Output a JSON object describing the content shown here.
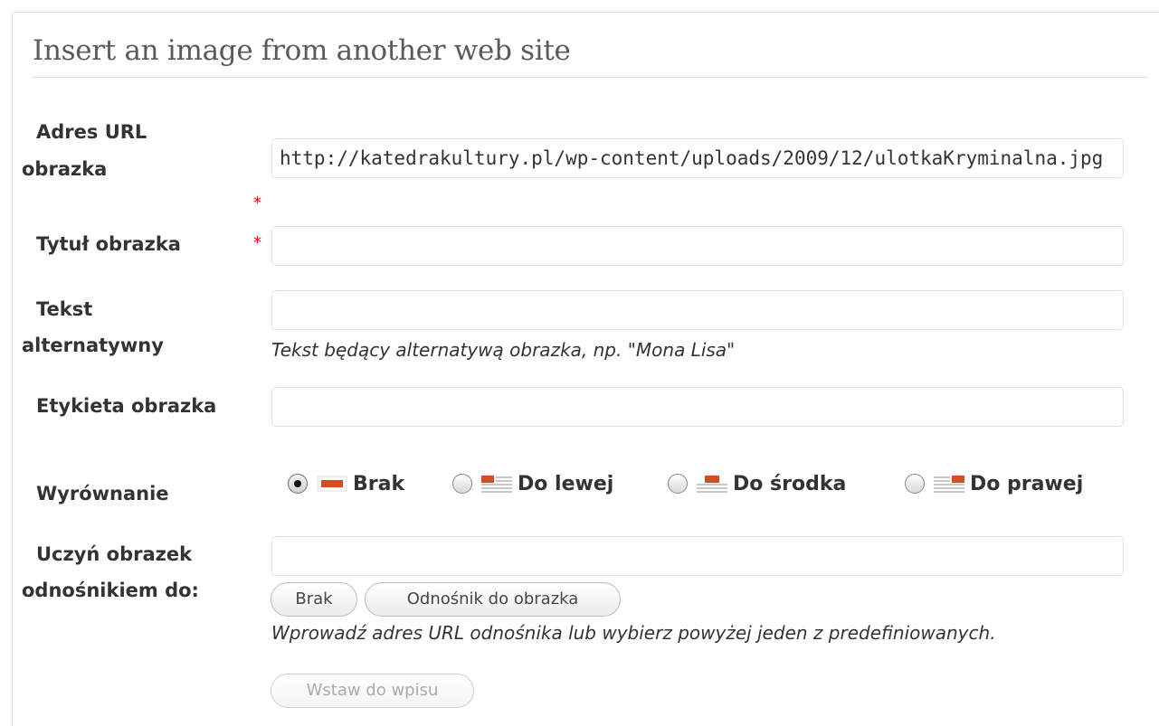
{
  "dialog": {
    "title": "Insert an image from another web site"
  },
  "fields": {
    "url": {
      "label_line1": "Adres URL",
      "label_line2": "obrazka",
      "required_mark": "*",
      "value": "http://katedrakultury.pl/wp-content/uploads/2009/12/ulotkaKryminalna.jpg"
    },
    "title": {
      "label": "Tytuł obrazka",
      "required_mark": "*",
      "value": ""
    },
    "alt": {
      "label_line1": "Tekst",
      "label_line2": "alternatywny",
      "value": "",
      "hint": "Tekst będący alternatywą obrazka, np. \"Mona Lisa\""
    },
    "caption": {
      "label": "Etykieta obrazka",
      "value": ""
    },
    "alignment": {
      "label": "Wyrównanie",
      "selected": "none",
      "options": [
        {
          "id": "none",
          "label": "Brak",
          "icon": "align-none-icon"
        },
        {
          "id": "left",
          "label": "Do lewej",
          "icon": "align-left-icon"
        },
        {
          "id": "center",
          "label": "Do środka",
          "icon": "align-center-icon"
        },
        {
          "id": "right",
          "label": "Do prawej",
          "icon": "align-right-icon"
        }
      ]
    },
    "link": {
      "label_line1": "Uczyń obrazek",
      "label_line2": "odnośnikiem do:",
      "value": "",
      "btn_none": "Brak",
      "btn_image": "Odnośnik do obrazka",
      "hint": "Wprowadź adres URL odnośnika lub wybierz powyżej jeden z predefiniowanych."
    }
  },
  "actions": {
    "insert_label": "Wstaw do wpisu"
  },
  "colors": {
    "accent_orange": "#d54e21",
    "icon_lines": "#c8c8c8",
    "required_red": "#ff0000"
  }
}
